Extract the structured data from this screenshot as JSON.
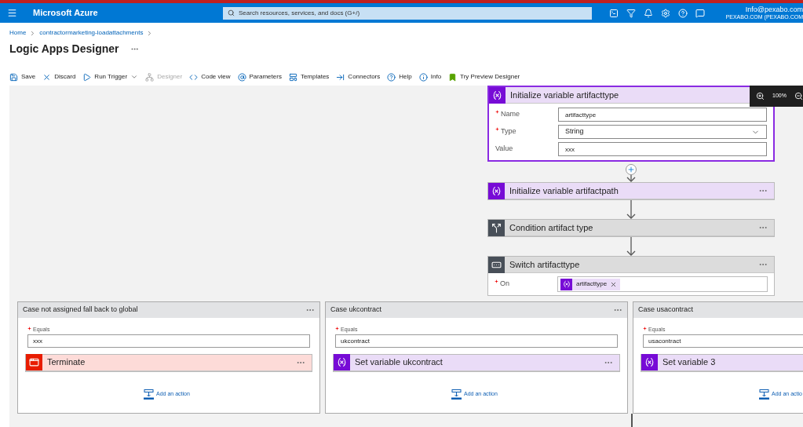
{
  "topbar": {
    "brand": "Microsoft Azure",
    "search": {
      "placeholder": "Search resources, services, and docs (G+/)"
    },
    "user": {
      "email": "Info@pexabo.com",
      "tenant": "PEXABO.COM (PEXABO.COM"
    }
  },
  "breadcrumb": [
    "Home",
    "contractormarketing-loadattachments"
  ],
  "page_title": "Logic Apps Designer",
  "toolbar": [
    {
      "kind": "save",
      "label": "Save",
      "disabled": false
    },
    {
      "kind": "discard",
      "label": "Discard",
      "disabled": false
    },
    {
      "kind": "run",
      "label": "Run Trigger",
      "disabled": false
    },
    {
      "kind": "designer",
      "label": "Designer",
      "disabled": true
    },
    {
      "kind": "code",
      "label": "Code view",
      "disabled": false
    },
    {
      "kind": "parameters",
      "label": "Parameters",
      "disabled": false
    },
    {
      "kind": "templates",
      "label": "Templates",
      "disabled": false
    },
    {
      "kind": "connectors",
      "label": "Connectors",
      "disabled": false
    },
    {
      "kind": "help",
      "label": "Help",
      "disabled": false
    },
    {
      "kind": "info",
      "label": "Info",
      "disabled": false
    },
    {
      "kind": "preview",
      "label": "Try Preview Designer",
      "disabled": false
    }
  ],
  "zoom": {
    "reading": "100%"
  },
  "flow": [
    {
      "kind": "variable",
      "title": "Initialize variable artifacttype",
      "selected": true,
      "fields": [
        {
          "kind": "text",
          "label": "Name",
          "required": true,
          "value": "artifacttype"
        },
        {
          "kind": "dropdown",
          "label": "Type",
          "required": true,
          "value": "String"
        },
        {
          "kind": "text",
          "label": "Value",
          "required": false,
          "value": "xxx"
        }
      ]
    },
    {
      "kind": "variable",
      "title": "Initialize variable artifactpath",
      "selected": false
    },
    {
      "kind": "condition",
      "title": "Condition artifact type",
      "selected": false
    },
    {
      "kind": "switch",
      "title": "Switch artifacttype",
      "selected": false,
      "fields": [
        {
          "kind": "token",
          "label": "On",
          "required": true,
          "value": "artifacttype"
        }
      ]
    }
  ],
  "cases": [
    {
      "title": "Case not assigned fall back to global",
      "equals_required": true,
      "equals_label": "Equals",
      "equals": "xxx",
      "action": {
        "kind": "terminate",
        "title": "Terminate"
      },
      "add_action": "Add an action"
    },
    {
      "title": "Case ukcontract",
      "equals_required": true,
      "equals_label": "Equals",
      "equals": "ukcontract",
      "action": {
        "kind": "variable",
        "title": "Set variable ukcontract"
      },
      "add_action": "Add an action"
    },
    {
      "title": "Case usacontract",
      "equals_required": true,
      "equals_label": "Equals",
      "equals": "usacontract",
      "action": {
        "kind": "variable",
        "title": "Set variable 3"
      },
      "add_action": "Add an actio"
    }
  ]
}
